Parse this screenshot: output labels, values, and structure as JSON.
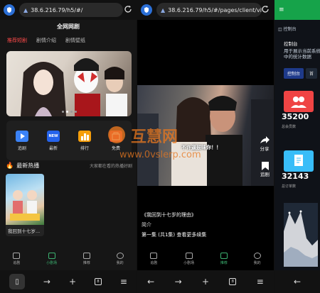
{
  "p1": {
    "url": "38.6.216.79/h5/#/",
    "title": "全网网剧",
    "tabs": [
      "推荐短剧",
      "剧情介绍",
      "剧情壁纸"
    ],
    "icons": [
      {
        "label": "追剧",
        "color": "#3b82f6",
        "icon": "play-icon"
      },
      {
        "label": "最新",
        "color": "#2563eb",
        "icon": "new-icon"
      },
      {
        "label": "排行",
        "color": "#f59e0b",
        "icon": "ranking-icon"
      },
      {
        "label": "免费",
        "color": "#ef4444",
        "icon": "free-icon"
      }
    ],
    "hot_label": "最新热播",
    "hot_sub": "大家都在看的热播好剧",
    "card_title": "我回到十七岁...",
    "bottom_tabs": [
      "追剧",
      "小剧场",
      "推荐",
      "我的"
    ],
    "active_bottom": 1
  },
  "p2": {
    "url": "38.6.216.79/h5/#/pages/client/video",
    "subtitle": "不许逼鼓昧你！！",
    "share": "分享",
    "bookmark": "追剧",
    "title": "《我回到十七岁的理由》",
    "intro": "简介",
    "episode": "第一集 (共1集) 查看更多续集",
    "bottom_tabs": [
      "追剧",
      "小剧场",
      "推荐",
      "我的"
    ],
    "active_bottom": 2
  },
  "p3": {
    "header_icon": "menu-icon",
    "breadcrumb": "控制台",
    "heading": "控制台",
    "desc": "用于展示当前系统中的统计数据",
    "tabs": [
      "控制台",
      "首"
    ],
    "stat1_value": "35200",
    "stat1_label": "总会员数",
    "stat2_value": "32143",
    "stat2_label": "总订单数",
    "accent": "#ef4444",
    "accent2": "#38bdf8"
  },
  "watermark": {
    "text": "互慧网",
    "sub": "www.0vslerp.com"
  }
}
